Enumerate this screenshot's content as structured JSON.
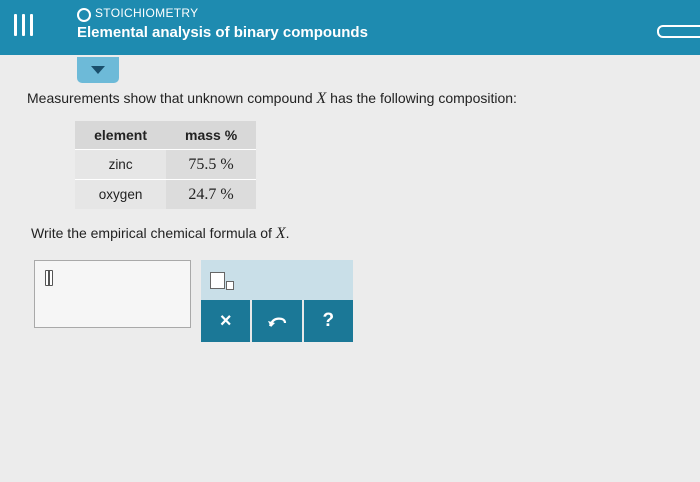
{
  "header": {
    "topic": "STOICHIOMETRY",
    "title": "Elemental analysis of binary compounds",
    "menu_icon": "menu-icon",
    "topic_icon": "circle-icon",
    "progress_icon": "progress-pill-icon"
  },
  "prompt": {
    "before": "Measurements show that unknown compound ",
    "variable": "X",
    "after": " has the following composition:"
  },
  "composition_table": {
    "headers": [
      "element",
      "mass %"
    ],
    "rows": [
      {
        "element": "zinc",
        "mass": "75.5 %"
      },
      {
        "element": "oxygen",
        "mass": "24.7 %"
      }
    ]
  },
  "question": {
    "before": "Write the empirical chemical formula of ",
    "variable": "X",
    "after": "."
  },
  "toolbar": {
    "clear_label": "×",
    "help_label": "?",
    "undo_icon": "undo-icon",
    "template_icon": "subscript-template-icon"
  },
  "colors": {
    "header_bg": "#1e8bb0",
    "page_bg": "#ececec",
    "toolbar_bg": "#1b7897",
    "toolbar_top_bg": "#c9dfe8"
  }
}
